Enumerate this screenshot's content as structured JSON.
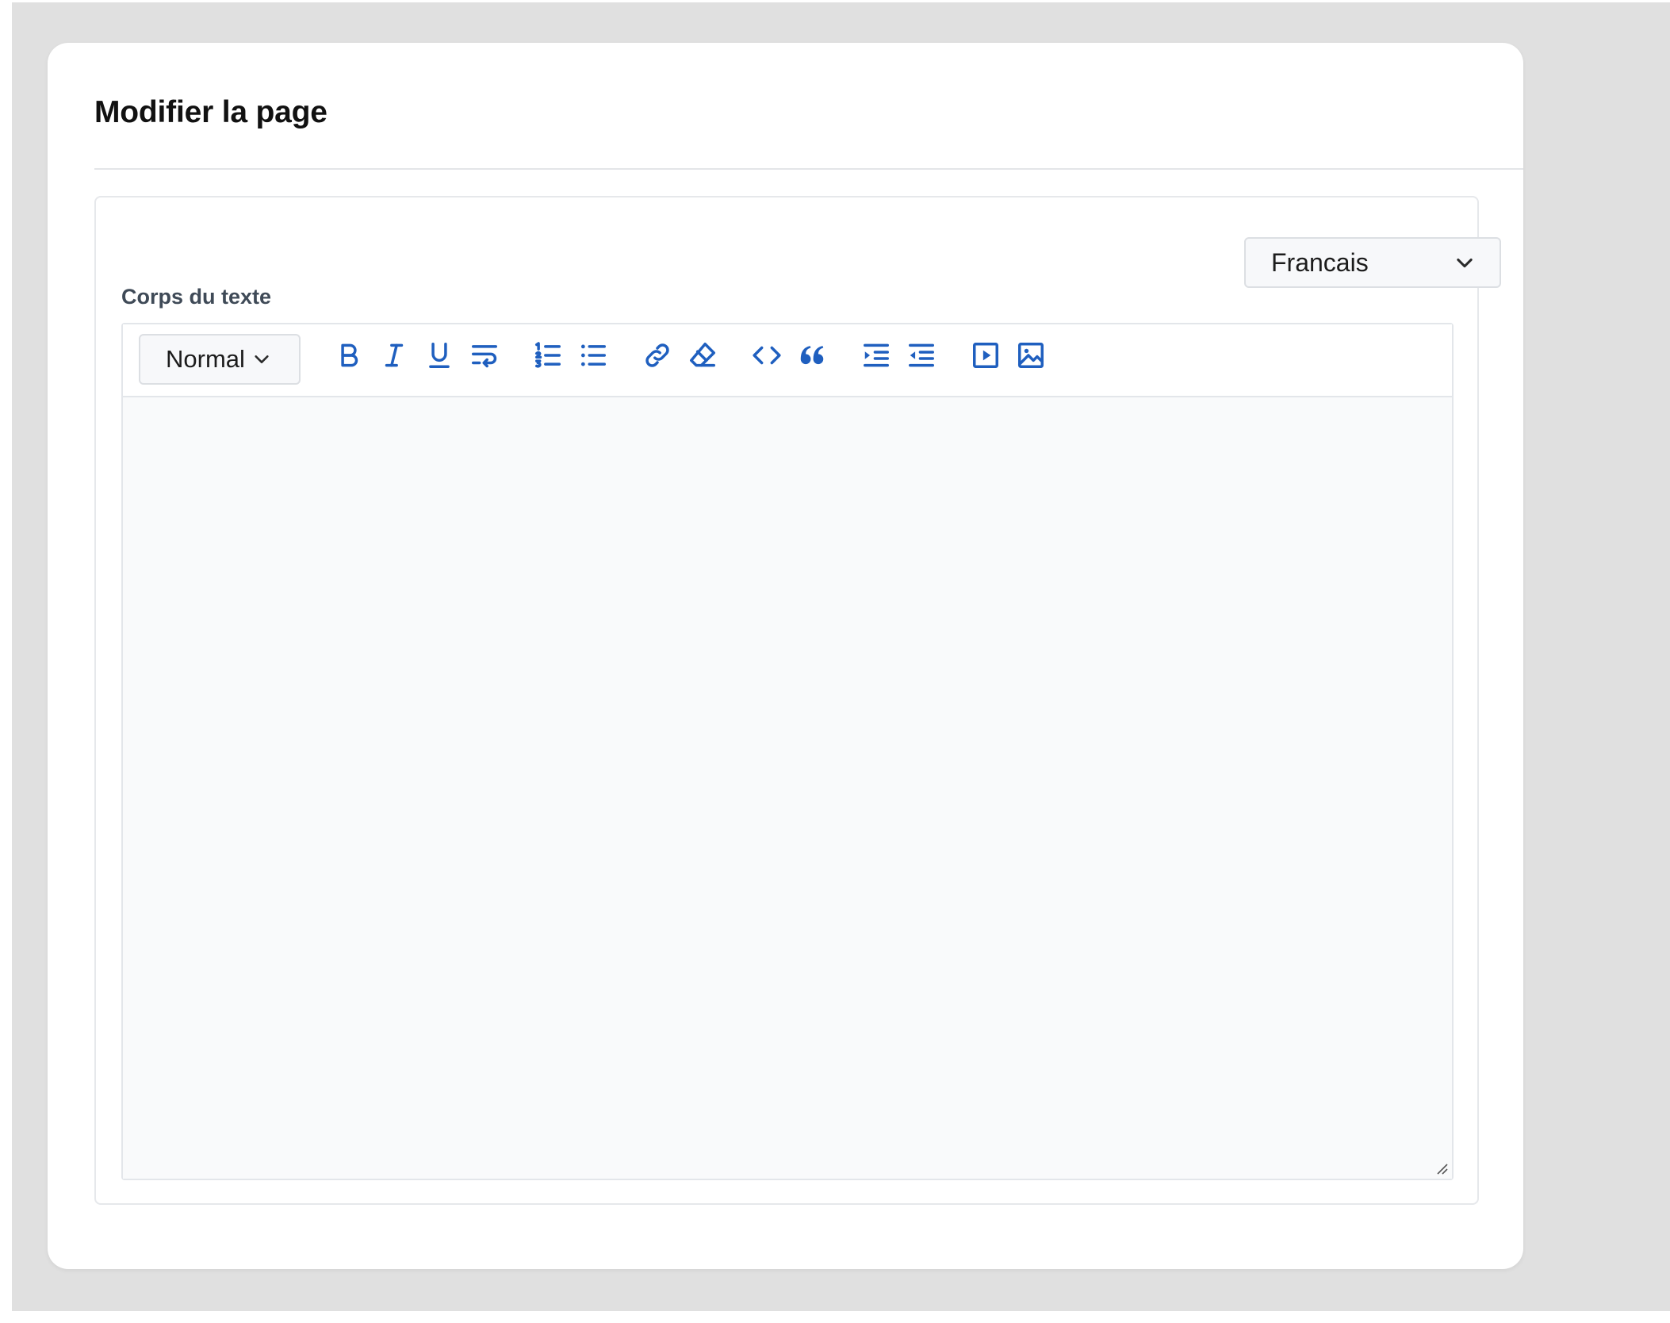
{
  "page": {
    "title": "Modifier la page"
  },
  "language_select": {
    "value": "Francais",
    "icon": "chevron-down-icon"
  },
  "field": {
    "label": "Corps du texte"
  },
  "editor": {
    "format_select": {
      "value": "Normal",
      "icon": "chevron-down-icon"
    },
    "toolbar": [
      {
        "name": "bold-icon"
      },
      {
        "name": "italic-icon"
      },
      {
        "name": "underline-icon"
      },
      {
        "name": "text-wrap-icon"
      },
      {
        "name": "ordered-list-icon"
      },
      {
        "name": "bullet-list-icon"
      },
      {
        "name": "link-icon"
      },
      {
        "name": "eraser-icon"
      },
      {
        "name": "code-icon"
      },
      {
        "name": "blockquote-icon"
      },
      {
        "name": "indent-icon"
      },
      {
        "name": "outdent-icon"
      },
      {
        "name": "video-icon"
      },
      {
        "name": "image-icon"
      }
    ],
    "content": ""
  },
  "colors": {
    "accent": "#1f5fbf",
    "backdrop": "#e0e0e0",
    "editor_background": "#f9fafb"
  }
}
